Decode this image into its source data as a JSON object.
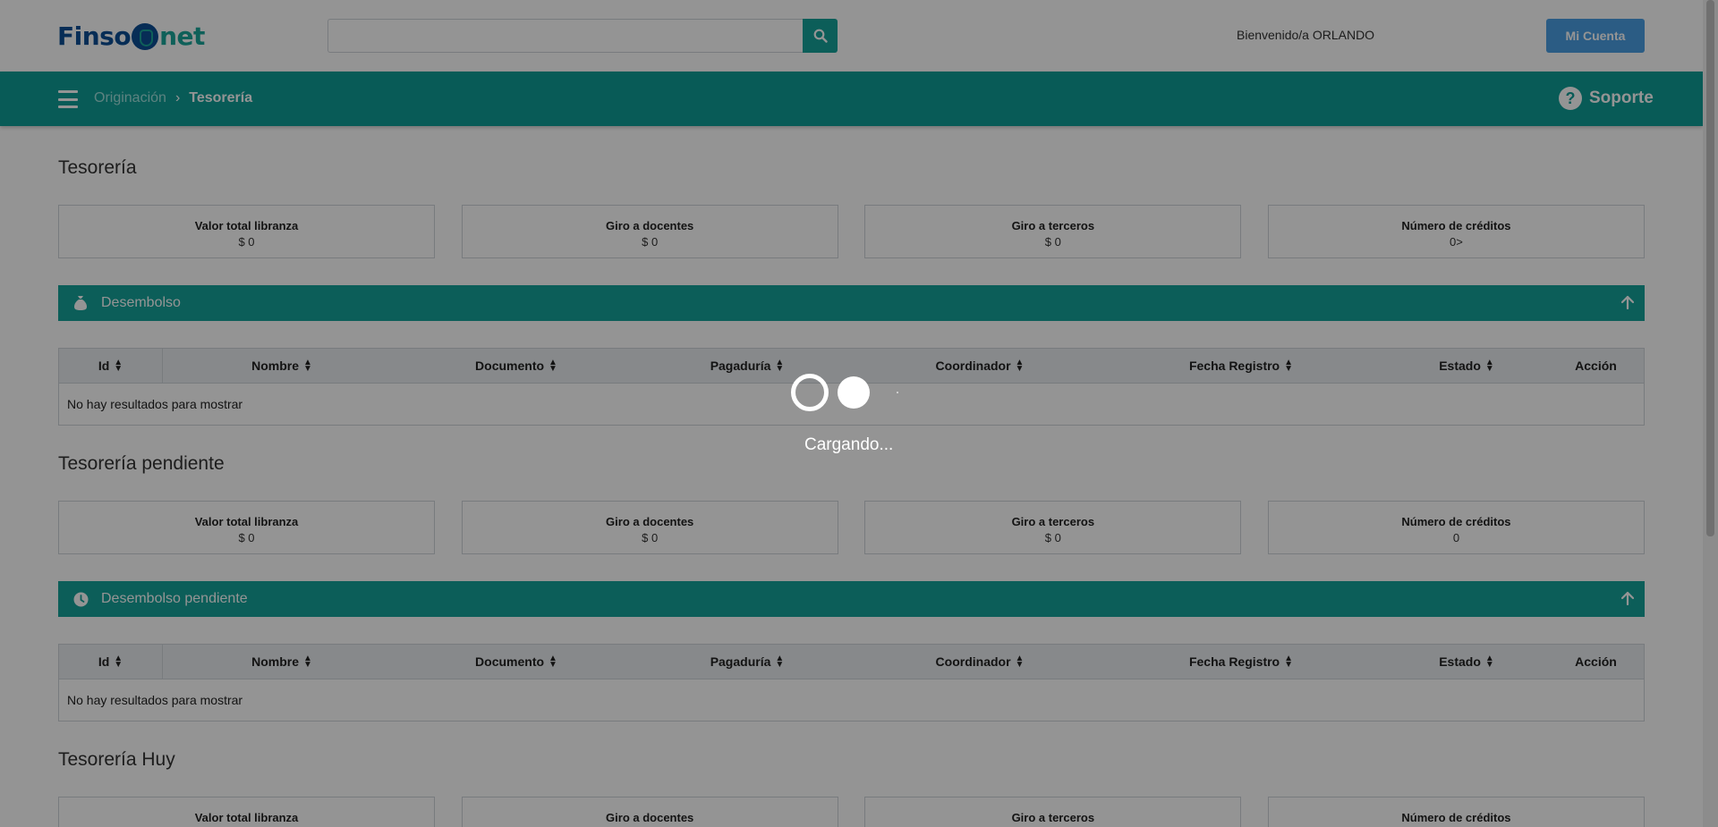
{
  "header": {
    "logo_text_left": "Finso",
    "logo_text_right": "net",
    "search_placeholder": "",
    "search_icon": "search-icon",
    "welcome": "Bienvenido/a ORLANDO",
    "account_label": "Mi Cuenta"
  },
  "nav": {
    "menu_icon": "hamburger-icon",
    "breadcrumb_parent": "Originación",
    "breadcrumb_current": "Tesorería",
    "support_label": "Soporte",
    "support_icon": "question-circle-icon"
  },
  "colors": {
    "teal": "#16a39a",
    "teal_nav": "#0f9d96",
    "account_blue": "#4a9fe3",
    "logo_blue": "#0d4f95"
  },
  "table_columns": [
    "Id",
    "Nombre",
    "Documento",
    "Pagaduría",
    "Coordinador",
    "Fecha Registro",
    "Estado",
    "Acción"
  ],
  "sections": [
    {
      "title": "Tesorería",
      "cards": [
        {
          "label": "Valor total libranza",
          "value": "$ 0"
        },
        {
          "label": "Giro a docentes",
          "value": "$ 0"
        },
        {
          "label": "Giro a terceros",
          "value": "$ 0"
        },
        {
          "label": "Número de créditos",
          "value": "0>"
        }
      ],
      "panel": {
        "title": "Desembolso",
        "icon": "money-bag-icon"
      },
      "empty_text": "No hay resultados para mostrar"
    },
    {
      "title": "Tesorería pendiente",
      "cards": [
        {
          "label": "Valor total libranza",
          "value": "$ 0"
        },
        {
          "label": "Giro a docentes",
          "value": "$ 0"
        },
        {
          "label": "Giro a terceros",
          "value": "$ 0"
        },
        {
          "label": "Número de créditos",
          "value": "0"
        }
      ],
      "panel": {
        "title": "Desembolso pendiente",
        "icon": "clock-icon"
      },
      "empty_text": "No hay resultados para mostrar"
    },
    {
      "title": "Tesorería Huy",
      "cards": [
        {
          "label": "Valor total libranza",
          "value": ""
        },
        {
          "label": "Giro a docentes",
          "value": ""
        },
        {
          "label": "Giro a terceros",
          "value": ""
        },
        {
          "label": "Número de créditos",
          "value": ""
        }
      ]
    }
  ],
  "overlay": {
    "loading_text": "Cargando..."
  }
}
